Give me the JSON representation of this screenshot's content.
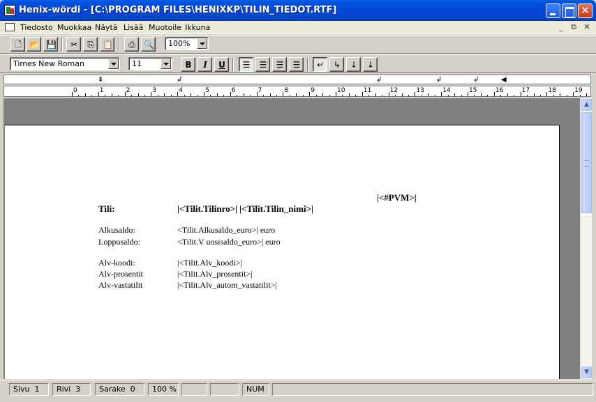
{
  "window": {
    "title": "Henix-wördi - [C:\\PROGRAM FILES\\HENIXKP\\TILIN_TIEDOT.RTF]",
    "close_glyph": "✕"
  },
  "menu": {
    "items": [
      "Tiedosto",
      "Muokkaa",
      "Näytä",
      "Lisää",
      "Muotoile",
      "Ikkuna"
    ],
    "mdi_controls": [
      "_",
      "⧉",
      "✕"
    ]
  },
  "toolbar": {
    "zoom": "100%",
    "font": "Times New Roman",
    "size": "11",
    "bold": "B",
    "italic": "I",
    "underline": "U"
  },
  "ruler": {
    "numbers": [
      "0",
      "1",
      "2",
      "3",
      "4",
      "5",
      "6",
      "7",
      "8",
      "9",
      "10",
      "11",
      "12",
      "13",
      "14",
      "15",
      "16",
      "17",
      "18",
      "19"
    ]
  },
  "document": {
    "date_field": "|<#PVM>|",
    "tili_label": "Tili:",
    "tili_value": "|<Tilit.Tilinro>| |<Tilit.Tilin_nimi>|",
    "alkusaldo_label": "Alkusaldo:",
    "alkusaldo_value": "<Tilit.Alkusaldo_euro>|  euro",
    "loppusaldo_label": "Loppusaldo:",
    "loppusaldo_value": "<Tilit.V uosisaldo_euro>| euro",
    "alv_koodi_label": "Alv-koodi:",
    "alv_koodi_value": "|<Tilit.Alv_koodi>|",
    "alv_prosentit_label": "Alv-prosentit",
    "alv_prosentit_value": "|<Tilit.Alv_prosentit>|",
    "alv_vastatilit_label": "Alv-vastatilit",
    "alv_vastatilit_value": "|<Tilit.Alv_autom_vastatilit>|"
  },
  "status": {
    "sivu_label": "Sivu",
    "sivu_value": "1",
    "rivi_label": "Rivi",
    "rivi_value": "3",
    "sarake_label": "Sarake",
    "sarake_value": "0",
    "zoom": "100 %",
    "num": "NUM"
  }
}
